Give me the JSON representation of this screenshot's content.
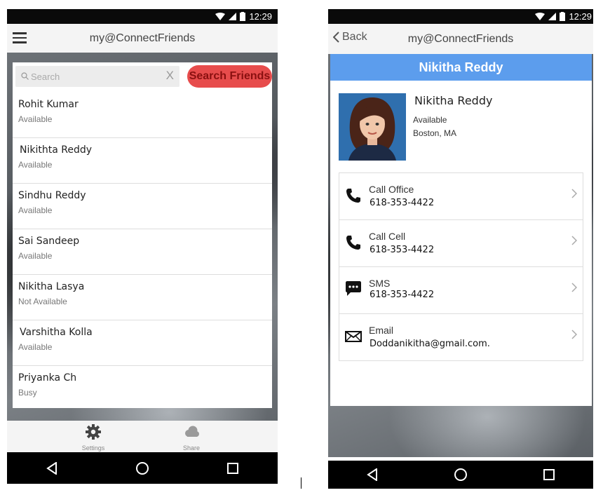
{
  "colors": {
    "accent_blue": "#5c9ded",
    "search_button_red": "#e74c4c",
    "status_bar": "#0a0a0a",
    "app_bar": "#f4f4f4"
  },
  "left_screen": {
    "status_bar": {
      "time": "12:29"
    },
    "app_bar": {
      "title": "my@ConnectFriends",
      "menu_icon": "hamburger-menu-icon"
    },
    "search": {
      "placeholder": "Search",
      "clear_label": "X",
      "button_label": "Search Friends"
    },
    "friends": [
      {
        "name": "Rohit Kumar",
        "status": "Available"
      },
      {
        "name": "Nikithta  Reddy",
        "status": "Available"
      },
      {
        "name": "Sindhu Reddy",
        "status": "Available"
      },
      {
        "name": "Sai Sandeep",
        "status": "Available"
      },
      {
        "name": "Nikitha Lasya",
        "status": "Not Available"
      },
      {
        "name": "Varshitha Kolla",
        "status": "Available"
      },
      {
        "name": "Priyanka Ch",
        "status": "Busy"
      }
    ],
    "tabs": [
      {
        "label": "Settings",
        "icon": "gear-icon"
      },
      {
        "label": "Share",
        "icon": "cloud-icon"
      }
    ]
  },
  "right_screen": {
    "status_bar": {
      "time": "12:29"
    },
    "app_bar": {
      "back_label": "Back",
      "title": "my@ConnectFriends"
    },
    "banner_name": "Nikitha Reddy",
    "profile": {
      "name": "Nikitha Reddy",
      "status": "Available",
      "location": "Boston, MA"
    },
    "actions": [
      {
        "label": "Call Office",
        "value": "618-353-4422",
        "icon": "phone-icon"
      },
      {
        "label": "Call Cell",
        "value": "618-353-4422",
        "icon": "phone-icon"
      },
      {
        "label": "SMS",
        "value": "618-353-4422",
        "icon": "chat-bubble-icon"
      },
      {
        "label": "Email",
        "value": "Doddanikitha@gmail.com.",
        "icon": "envelope-icon"
      }
    ]
  }
}
